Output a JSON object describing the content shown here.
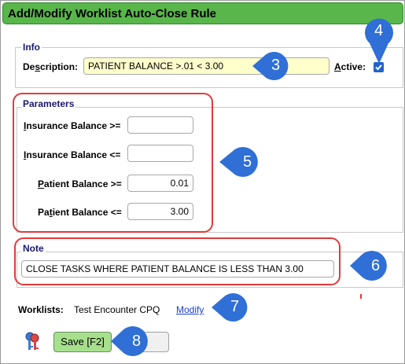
{
  "window": {
    "title": "Add/Modify Worklist Auto-Close Rule"
  },
  "info": {
    "legend": "Info",
    "description_label_pre": "De",
    "description_label_ul": "s",
    "description_label_post": "cription:",
    "description_value": "PATIENT BALANCE >.01 < 3.00",
    "active_label_ul": "A",
    "active_label_post": "ctive:",
    "active_checked": true
  },
  "parameters": {
    "legend": "Parameters",
    "rows": [
      {
        "label_ul": "I",
        "label_post": "nsurance Balance >=",
        "value": ""
      },
      {
        "label_ul": "I",
        "label_post": "nsurance Balance <=",
        "value": ""
      },
      {
        "label_pre": "",
        "label_ul": "P",
        "label_post": "atient Balance >=",
        "value": "0.01"
      },
      {
        "label_pre": "Pa",
        "label_ul": "t",
        "label_post": "ient Balance <=",
        "value": "3.00"
      }
    ]
  },
  "note": {
    "legend": "Note",
    "value": "CLOSE TASKS WHERE PATIENT BALANCE IS LESS THAN 3.00"
  },
  "worklists": {
    "label": "Worklists:",
    "value": "Test Encounter CPQ",
    "modify_link": "Modify"
  },
  "buttons": {
    "save": "Save [F2]"
  },
  "callouts": [
    "3",
    "4",
    "5",
    "6",
    "7",
    "8"
  ],
  "colors": {
    "title_green": "#59b64a",
    "callout_blue": "#2f6fd6",
    "highlight_red": "#e23a3a",
    "desc_bg": "#ffffcc"
  }
}
